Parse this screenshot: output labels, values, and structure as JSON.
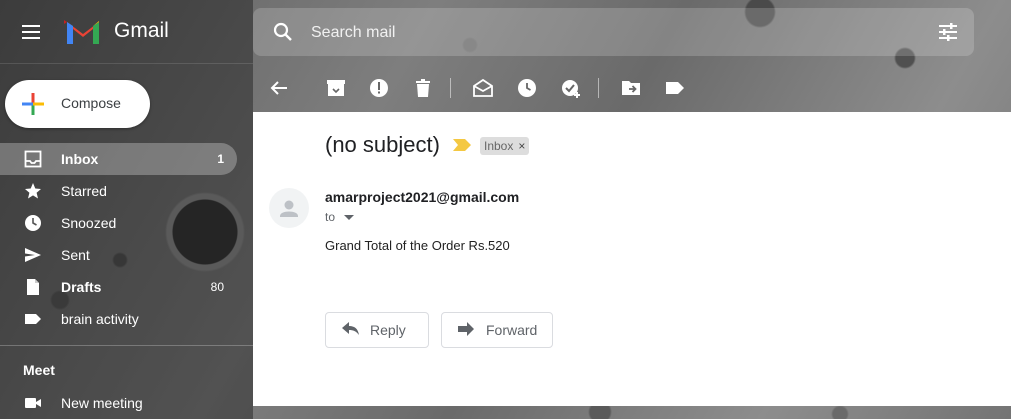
{
  "app": {
    "name": "Gmail"
  },
  "search": {
    "placeholder": "Search mail"
  },
  "compose": {
    "label": "Compose"
  },
  "sidebar": {
    "items": [
      {
        "label": "Inbox",
        "count": "1",
        "icon": "inbox-icon"
      },
      {
        "label": "Starred",
        "count": "",
        "icon": "star-icon"
      },
      {
        "label": "Snoozed",
        "count": "",
        "icon": "clock-icon"
      },
      {
        "label": "Sent",
        "count": "",
        "icon": "send-icon"
      },
      {
        "label": "Drafts",
        "count": "80",
        "icon": "draft-icon"
      },
      {
        "label": "brain activity",
        "count": "",
        "icon": "label-icon"
      }
    ],
    "meet": {
      "header": "Meet",
      "new_meeting": "New meeting"
    }
  },
  "toolbar": {
    "icons": [
      "back-arrow-icon",
      "archive-icon",
      "report-spam-icon",
      "delete-icon",
      "mark-unread-icon",
      "snooze-icon",
      "add-to-tasks-icon",
      "move-to-icon",
      "labels-icon"
    ]
  },
  "message": {
    "subject": "(no subject)",
    "label_chip": "Inbox",
    "label_chip_remove": "×",
    "sender": "amarproject2021@gmail.com",
    "to": "to",
    "body": "Grand Total of the Order Rs.520",
    "reply_label": "Reply",
    "forward_label": "Forward"
  },
  "colors": {
    "importance": "#f4c842",
    "compose_red": "#ea4335",
    "compose_blue": "#4285f4",
    "compose_green": "#34a853",
    "compose_yellow": "#fbbc04"
  }
}
